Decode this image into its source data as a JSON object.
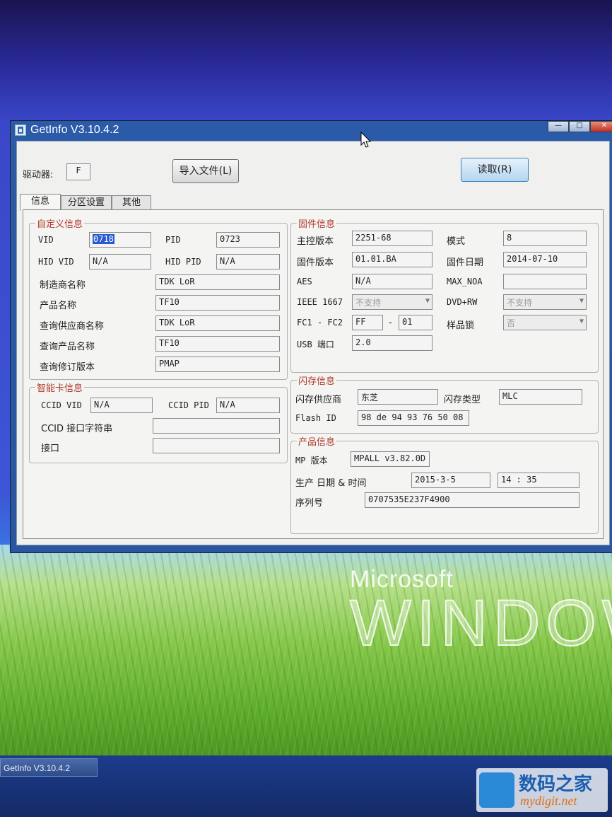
{
  "window": {
    "title": "GetInfo V3.10.4.2",
    "controls": {
      "minimize": "—",
      "maximize": "□",
      "close": "✕"
    }
  },
  "top": {
    "drive_label": "驱动器:",
    "drive_value": "F",
    "import_button": "导入文件(L)",
    "read_button": "读取(R)"
  },
  "tabs": [
    "信息",
    "分区设置",
    "其他"
  ],
  "custom_info": {
    "title": "自定义信息",
    "vid_label": "VID",
    "vid_value": "0718",
    "pid_label": "PID",
    "pid_value": "0723",
    "hid_vid_label": "HID VID",
    "hid_vid_value": "N/A",
    "hid_pid_label": "HID PID",
    "hid_pid_value": "N/A",
    "manufacturer_label": "制造商名称",
    "manufacturer_value": "TDK LoR",
    "product_label": "产品名称",
    "product_value": "TF10",
    "query_vendor_label": "查询供应商名称",
    "query_vendor_value": "TDK LoR",
    "query_product_label": "查询产品名称",
    "query_product_value": "TF10",
    "query_revision_label": "查询修订版本",
    "query_revision_value": "PMAP"
  },
  "smart_card": {
    "title": "智能卡信息",
    "ccid_vid_label": "CCID VID",
    "ccid_vid_value": "N/A",
    "ccid_pid_label": "CCID PID",
    "ccid_pid_value": "N/A",
    "ccid_string_label": "CCID 接口字符串",
    "ccid_string_value": "",
    "interface_label": "接口",
    "interface_value": ""
  },
  "firmware": {
    "title": "固件信息",
    "controller_label": "主控版本",
    "controller_value": "2251-68",
    "mode_label": "模式",
    "mode_value": "8",
    "fw_version_label": "固件版本",
    "fw_version_value": "01.01.BA",
    "fw_date_label": "固件日期",
    "fw_date_value": "2014-07-10",
    "aes_label": "AES",
    "aes_value": "N/A",
    "max_noa_label": "MAX_NOA",
    "max_noa_value": "",
    "ieee_label": "IEEE 1667",
    "ieee_value": "不支持",
    "dvdrw_label": "DVD+RW",
    "dvdrw_value": "不支持",
    "fc_label": "FC1 - FC2",
    "fc1_value": "FF",
    "fc_dash": "-",
    "fc2_value": "01",
    "sample_lock_label": "样品锁",
    "sample_lock_value": "否",
    "usb_label": "USB 端口",
    "usb_value": "2.0"
  },
  "flash": {
    "title": "闪存信息",
    "vendor_label": "闪存供应商",
    "vendor_value": "东芝",
    "type_label": "闪存类型",
    "type_value": "MLC",
    "id_label": "Flash ID",
    "id_value": "98 de 94 93 76 50 08"
  },
  "product": {
    "title": "产品信息",
    "mp_label": "MP 版本",
    "mp_value": "MPALL v3.82.0D",
    "date_label": "生产 日期 & 时间",
    "date_value": "2015-3-5",
    "time_value": "14 : 35",
    "serial_label": "序列号",
    "serial_value": "0707535E237F4900"
  },
  "desktop": {
    "brand_small": "Microsoft",
    "brand_large": "WINDOW",
    "taskbar_item": "GetInfo V3.10.4.2",
    "watermark_cn": "数码之家",
    "watermark_url": "mydigit.net"
  }
}
